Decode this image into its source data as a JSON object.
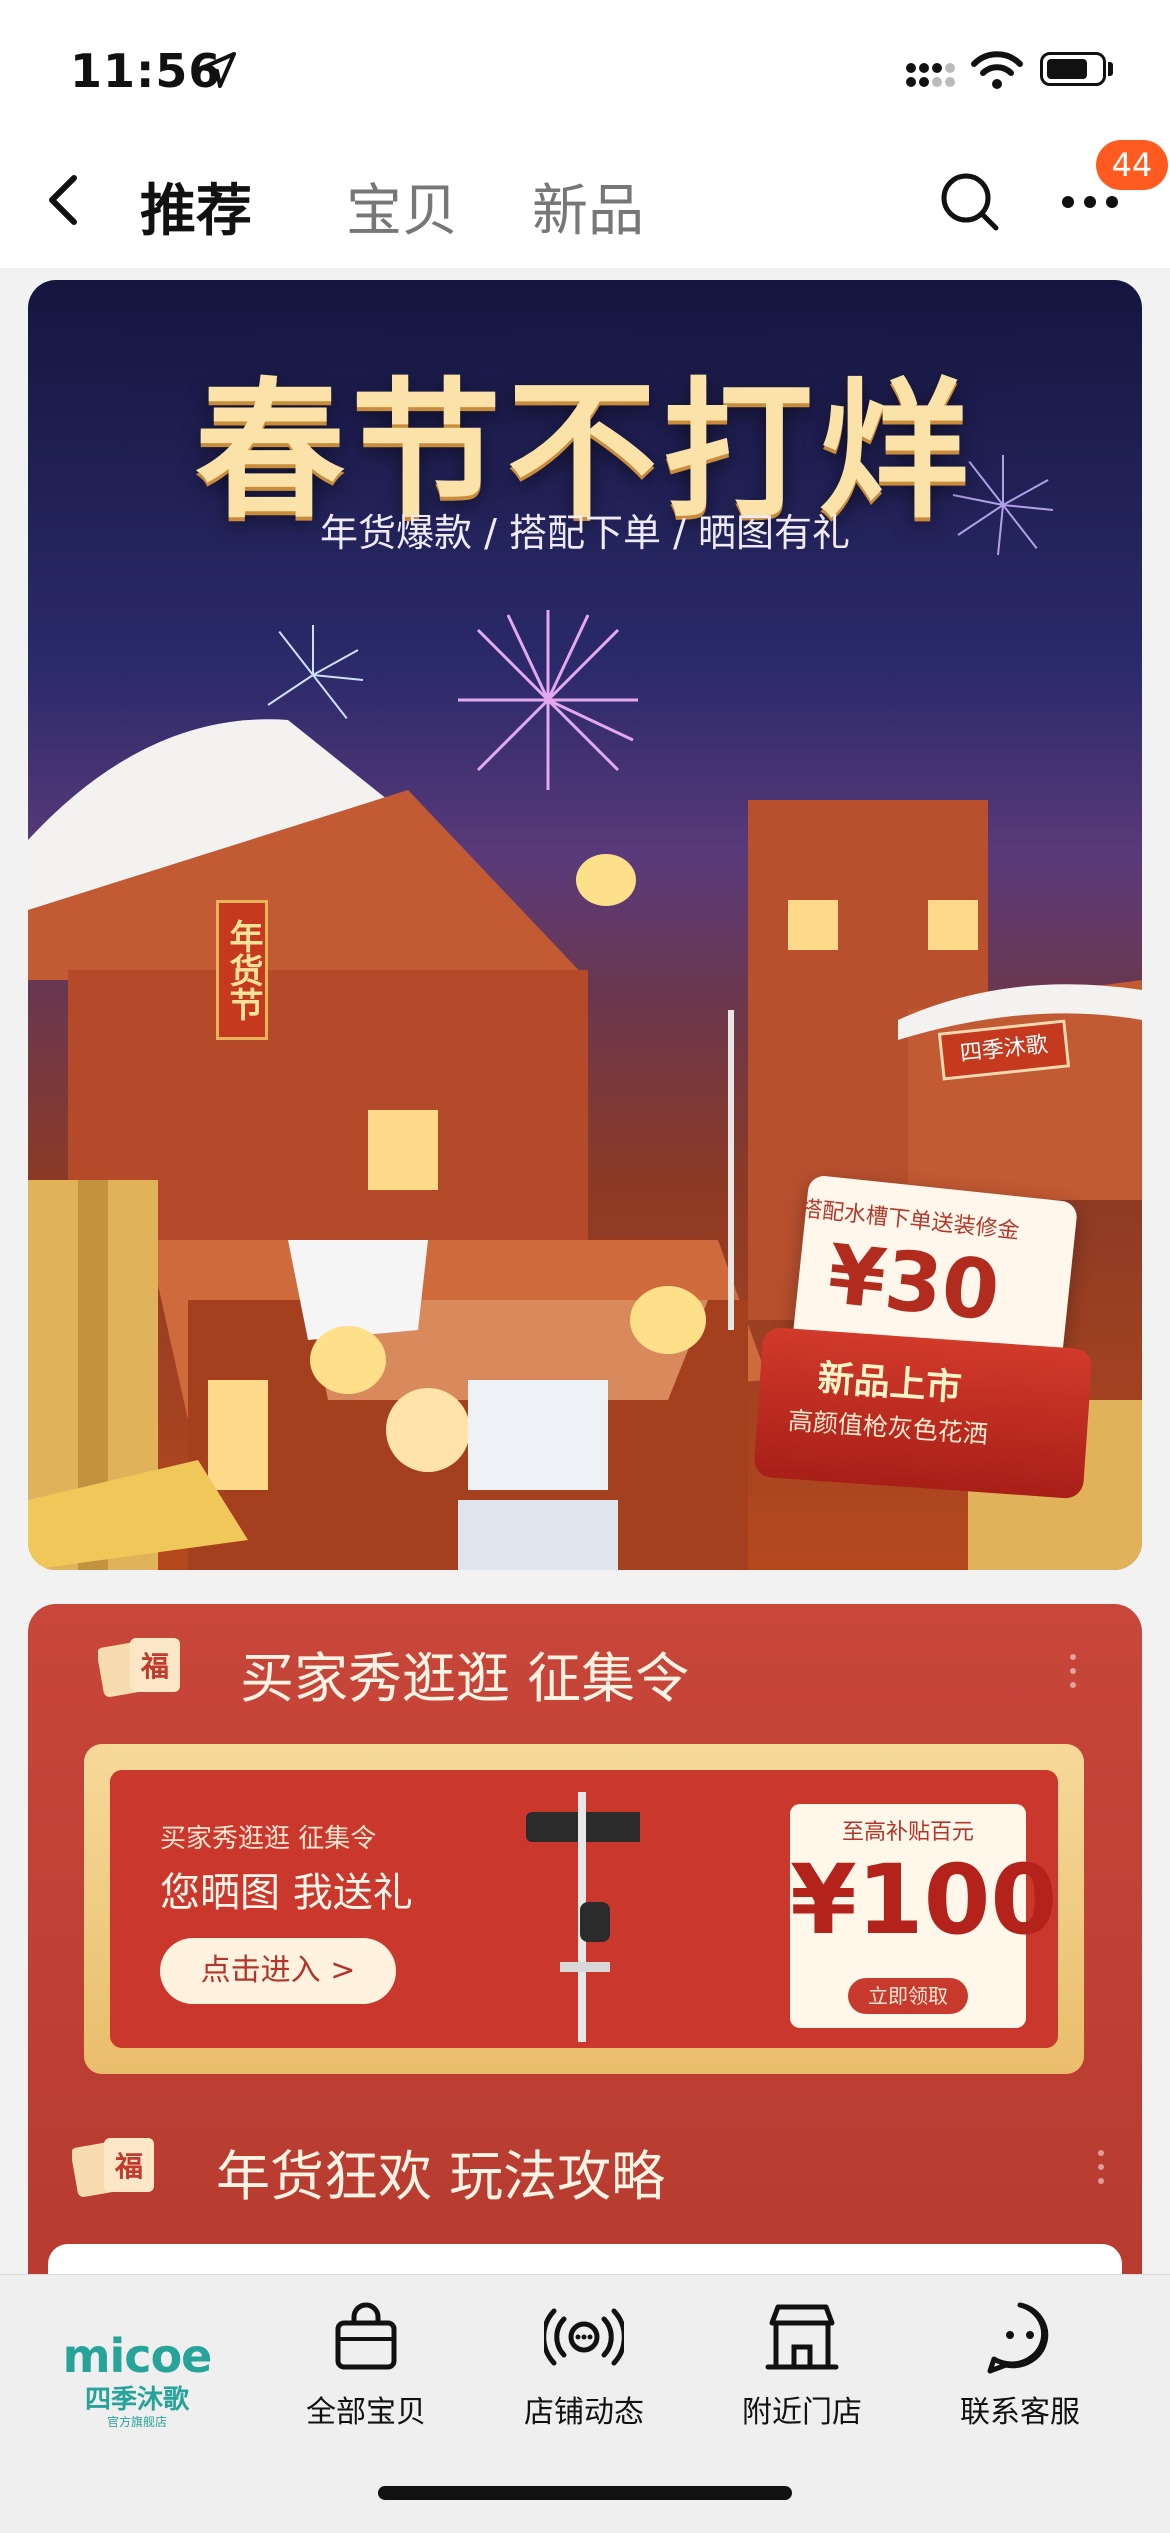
{
  "status_bar": {
    "time": "11:56"
  },
  "nav": {
    "tabs": [
      {
        "label": "推荐",
        "active": true
      },
      {
        "label": "宝贝",
        "active": false
      },
      {
        "label": "新品",
        "active": false
      }
    ],
    "badge_count": "44"
  },
  "banner": {
    "title": "春节不打烊",
    "subtitle": "年货爆款 / 搭配下单 / 晒图有礼",
    "sign_label": "年货节",
    "shop_sign": "四季沐歌",
    "coupon": {
      "top_text": "搭配水槽下单送装修金",
      "value": "¥30",
      "main_text": "新品上市",
      "sub_text": "高颜值枪灰色花洒"
    }
  },
  "promo": {
    "section1_title": "买家秀逛逛 征集令",
    "section1_icon_text": "福",
    "inner_small": "买家秀逛逛 征集令",
    "inner_big": "您晒图 我送礼",
    "enter_button": "点击进入 >",
    "ticket_top": "至高补贴百元",
    "ticket_value": "¥100",
    "ticket_button": "立即领取",
    "section2_title": "年货狂欢 玩法攻略",
    "section2_icon_text": "福"
  },
  "tabbar": {
    "logo_en": "micoe",
    "logo_cn": "四季沐歌",
    "logo_tiny": "官方旗舰店",
    "items": [
      {
        "label": "全部宝贝",
        "icon": "shopping-bag-icon"
      },
      {
        "label": "店铺动态",
        "icon": "broadcast-icon"
      },
      {
        "label": "附近门店",
        "icon": "store-icon"
      },
      {
        "label": "联系客服",
        "icon": "chat-face-icon"
      }
    ]
  },
  "colors": {
    "accent_badge": "#ff5a1f",
    "promo_red": "#c8463a",
    "logo_teal": "#27a39a"
  }
}
